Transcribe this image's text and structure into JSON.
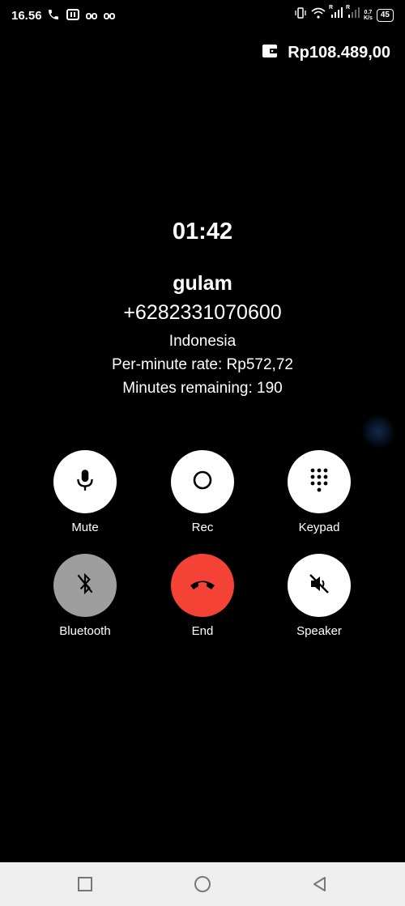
{
  "status_bar": {
    "time": "16.56",
    "icons_left": [
      "phone-icon",
      "app-icon",
      "link-icon",
      "link-icon"
    ],
    "icons_right": [
      "vibrate-icon",
      "wifi-icon",
      "signal-icon",
      "signal-icon"
    ],
    "roaming_mark": "R",
    "network_speed_value": "0.7",
    "network_speed_unit": "K/s",
    "battery": "45"
  },
  "balance": {
    "amount": "Rp108.489,00",
    "icon": "wallet-icon"
  },
  "call": {
    "timer": "01:42",
    "caller_name": "gulam",
    "caller_number": "+6282331070600",
    "country": "Indonesia",
    "rate": "Per-minute rate: Rp572,72",
    "minutes_remaining": "Minutes remaining: 190"
  },
  "controls": {
    "mute": "Mute",
    "rec": "Rec",
    "keypad": "Keypad",
    "bluetooth": "Bluetooth",
    "end": "End",
    "speaker": "Speaker"
  },
  "colors": {
    "background": "#000000",
    "end_call": "#f44336",
    "bluetooth_inactive": "#9e9e9e",
    "nav_bar": "#eeeeee"
  },
  "nav": {
    "icons": [
      "recent-apps-icon",
      "home-icon",
      "back-icon"
    ]
  }
}
